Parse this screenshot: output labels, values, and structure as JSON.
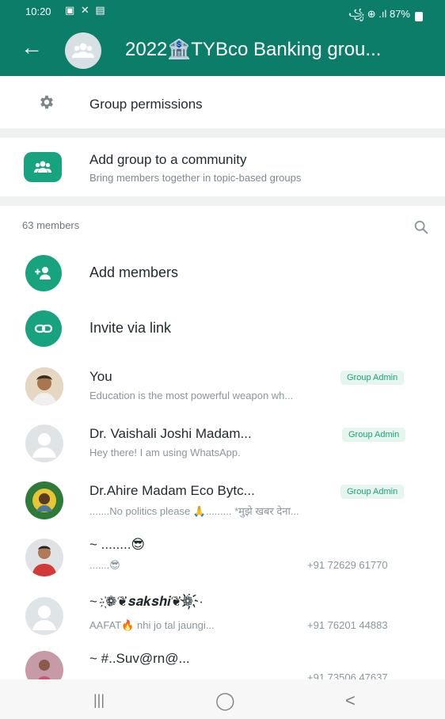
{
  "status_bar": {
    "time": "10:20",
    "left_icons": "▣ ✕ ▤",
    "right_text": "꧁ ⊕ .ıl 87%"
  },
  "header": {
    "back_glyph": "←",
    "title": "2022🏦TYBco Banking grou..."
  },
  "settings": {
    "permissions_label": "Group permissions",
    "community_title": "Add group to a community",
    "community_subtitle": "Bring members together in topic-based groups"
  },
  "members_section": {
    "count_label": "63 members",
    "add_members_label": "Add members",
    "invite_label": "Invite via link"
  },
  "members": [
    {
      "name": "You",
      "status": "Education is the most powerful weapon wh...",
      "badge": "Group Admin",
      "phone": ""
    },
    {
      "name": "Dr. Vaishali Joshi Madam...",
      "status": "Hey there! I am using WhatsApp.",
      "badge": "Group Admin",
      "phone": ""
    },
    {
      "name": "Dr.Ahire Madam Eco Bytc...",
      "status": ".......No politics please 🙏......... *मुझे खबर देना...",
      "badge": "Group Admin",
      "phone": ""
    },
    {
      "name": "~ ........😎",
      "status": ".......😎",
      "badge": "",
      "phone": "+91 72629 61770"
    },
    {
      "name": "~ ·҉❁❦𝒔𝒂𝒌𝒔𝒉𝒊❦❁҉·",
      "status": "AAFAT🔥 nhi jo tal jaungi...",
      "badge": "",
      "phone": "+91 76201 44883"
    },
    {
      "name": "~ #..Suv@rn@...",
      "status": "",
      "badge": "",
      "phone": "+91 73506 47637"
    }
  ],
  "navbar": {
    "recent": "|||",
    "home": "◯",
    "back": "<"
  },
  "colors": {
    "header_bg": "#0b7d69",
    "accent": "#18a37f",
    "badge_text": "#1aa37a"
  }
}
